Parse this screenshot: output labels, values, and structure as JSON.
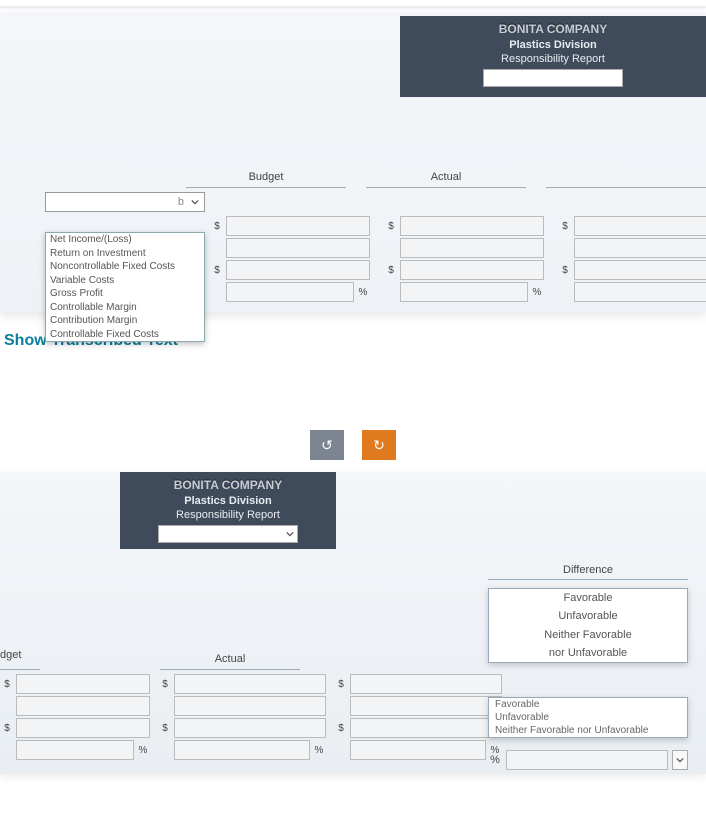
{
  "top": {
    "company": "BONITA COMPANY",
    "division": "Plastics Division",
    "report": "Responsibility Report",
    "col_budget": "Budget",
    "col_actual": "Actual",
    "placeholder_sel": "b",
    "options": [
      "Net Income/(Loss)",
      "Return on Investment",
      "Noncontrollable Fixed Costs",
      "Variable Costs",
      "Gross Profit",
      "Controllable Margin",
      "Contribution Margin",
      "Controllable Fixed Costs"
    ],
    "sym_dollar": "$",
    "sym_percent": "%"
  },
  "link": {
    "show": "Show Transcribed Text"
  },
  "mid": {
    "undo_glyph": "↺",
    "redo_glyph": "↻"
  },
  "bottom": {
    "company": "BONITA COMPANY",
    "division": "Plastics Division",
    "report": "Responsibility Report",
    "col_dget": "dget",
    "col_actual": "Actual",
    "col_diff": "Difference",
    "diff_opts": [
      "Favorable",
      "Unfavorable",
      "Neither Favorable",
      "nor Unfavorable"
    ],
    "fav_opts": [
      "Favorable",
      "Unfavorable",
      "Neither Favorable nor Unfavorable"
    ],
    "sym_dollar": "$",
    "sym_percent": "%"
  }
}
